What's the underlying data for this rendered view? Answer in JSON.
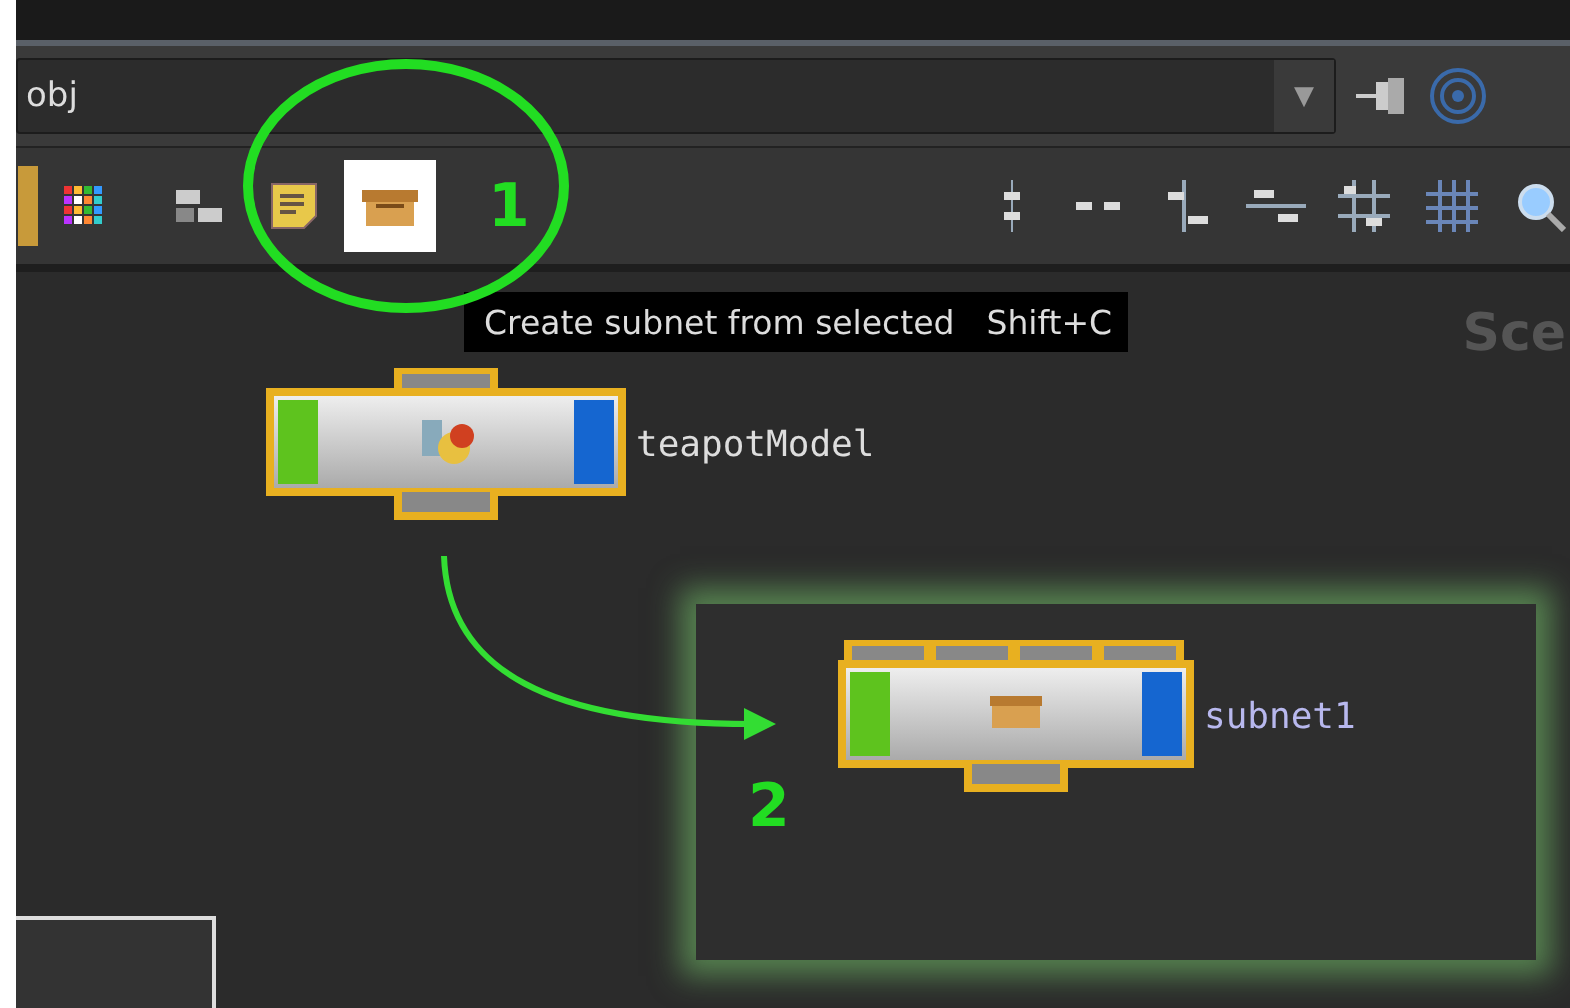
{
  "path_bar": {
    "path": "obj",
    "dropdown_arrow": "▼"
  },
  "toolbar": {
    "tools": [
      {
        "kind": "partial",
        "selected": false
      },
      {
        "kind": "palette",
        "selected": false
      },
      {
        "kind": "layout",
        "selected": false
      },
      {
        "kind": "note",
        "selected": false
      },
      {
        "kind": "subnet",
        "selected": true
      }
    ],
    "align_tools": [
      {
        "kind": "vdots"
      },
      {
        "kind": "hdots"
      },
      {
        "kind": "valign"
      },
      {
        "kind": "halign"
      },
      {
        "kind": "grid"
      },
      {
        "kind": "gridfine"
      },
      {
        "kind": "search"
      }
    ]
  },
  "tooltip": {
    "text": "Create subnet from selected",
    "shortcut": "Shift+C"
  },
  "canvas_label": "Sce",
  "nodes": [
    {
      "name": "teapotModel",
      "kind": "geometry",
      "selected": true
    },
    {
      "name": "subnet1",
      "kind": "subnet",
      "selected": true
    }
  ],
  "annotations": [
    {
      "number": "1"
    },
    {
      "number": "2"
    }
  ]
}
